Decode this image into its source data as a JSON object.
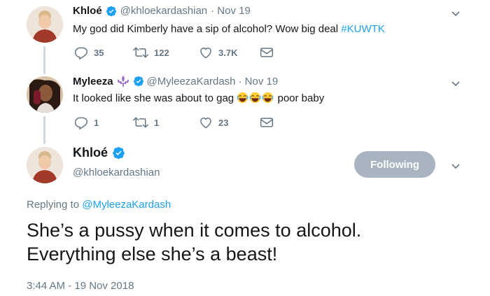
{
  "tweets": [
    {
      "display_name": "Khloé",
      "handle": "@khloekardashian",
      "date": "· Nov 19",
      "text_prefix": "My god did Kimberly have a sip of alcohol? Wow big deal ",
      "hashtag": "#KUWTK",
      "replies": "35",
      "retweets": "122",
      "likes": "3.7K"
    },
    {
      "display_name": "Myleeza",
      "handle": "@MyleezaKardash",
      "date": "· Nov 19",
      "text_prefix": "It looked like she was about to gag ",
      "text_suffix": " poor baby",
      "replies": "1",
      "retweets": "1",
      "likes": "23"
    }
  ],
  "main_tweet": {
    "display_name": "Khloé",
    "handle": "@khloekardashian",
    "follow_label": "Following",
    "replying_to_prefix": "Replying to ",
    "replying_to_handle": "@MyleezaKardash",
    "text_line1": "She’s a pussy when it comes to alcohol.",
    "text_line2": "Everything else she’s a beast!",
    "timestamp": "3:44 AM - 19 Nov 2018"
  },
  "colors": {
    "link": "#1da1f2",
    "muted": "#657786",
    "verified": "#1da1f2",
    "follow_button": "#a8b5c0",
    "thread_line": "#ccd6dd"
  },
  "icons": [
    "chevron-down-icon",
    "verified-icon",
    "reply-icon",
    "retweet-icon",
    "like-icon",
    "dm-icon",
    "fleur-de-lis-icon",
    "laughing-emoji"
  ]
}
